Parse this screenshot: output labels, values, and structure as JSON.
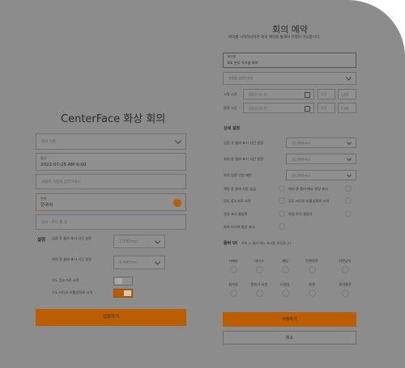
{
  "colors": {
    "overlay": "#8c8c8c",
    "accent": "#ba5d04"
  },
  "left": {
    "title": "CenterFace 화상 회의",
    "meeting_name_placeholder": "회의 이름",
    "schedule_label": "일시",
    "schedule_value": "2022-07-25 AM 9:00",
    "user_name_placeholder": "사용자 이름을 입력하세요",
    "language_label": "언어",
    "language_value": "한국어",
    "account_placeholder": "일시 : 연도.월.일",
    "settings_label": "설정",
    "setting1_label": "입장 후 돌바 표시 시간 설정",
    "setting1_value": "2,000(ms)",
    "setting2_label": "회의 후 돌바 표시 시간 설정",
    "setting2_value": "4,000(ms)",
    "toggle1_label": "무도 음소거로 시작",
    "toggle2_label": "무도 비디오 비활성화로 시작",
    "submit_label": "입장하기"
  },
  "right": {
    "title": "회의 예약",
    "subtitle": "회의를 시작하시려면 회의 예약을 통해야 진행이 가능합니다.",
    "name_label": "회의명",
    "name_value": "8호 본부 워크샵 회의",
    "type_placeholder": "설명을 입력하세요",
    "start_label": "시작 시간",
    "start_date": "2022-10-31",
    "start_ampm": "오전",
    "start_time": "1:00",
    "end_label": "종료 시간",
    "end_date": "2022-10-31",
    "end_ampm": "오전",
    "end_time": "2:00",
    "details_title": "상세 설정",
    "d1_label": "입장 후 돌바 표시 시간 설정",
    "d1_value": "20,000(ms)",
    "d2_label": "회의 중 돌바 표시 시간 설정",
    "d2_value": "20,000(ms)",
    "d3_label": "회의 입장 인원 제한",
    "d3_value": "20,000(ms)",
    "chk": [
      "채팅 중 돌바 자동 숨김",
      "회의 중 돌바 메뉴 항상 표시",
      "무도 음소거로 시작",
      "무도 비디오 비활성화로 시작",
      "영상 표시 활성화",
      "마일 보기 설정시",
      "회의 타이머 항상 표시"
    ],
    "toolbar_title": "돌바 UI",
    "toolbar_desc": "회의 시 돌바 메뉴 표시를 설정합니다.",
    "grid": [
      "카메라",
      "마이크",
      "채팅",
      "전체화면",
      "화면공유",
      "참가자",
      "탈퇴기 요청",
      "타일뷰",
      "설정",
      "회의종료"
    ],
    "submit_label": "수정하기",
    "cancel_label": "취소"
  }
}
